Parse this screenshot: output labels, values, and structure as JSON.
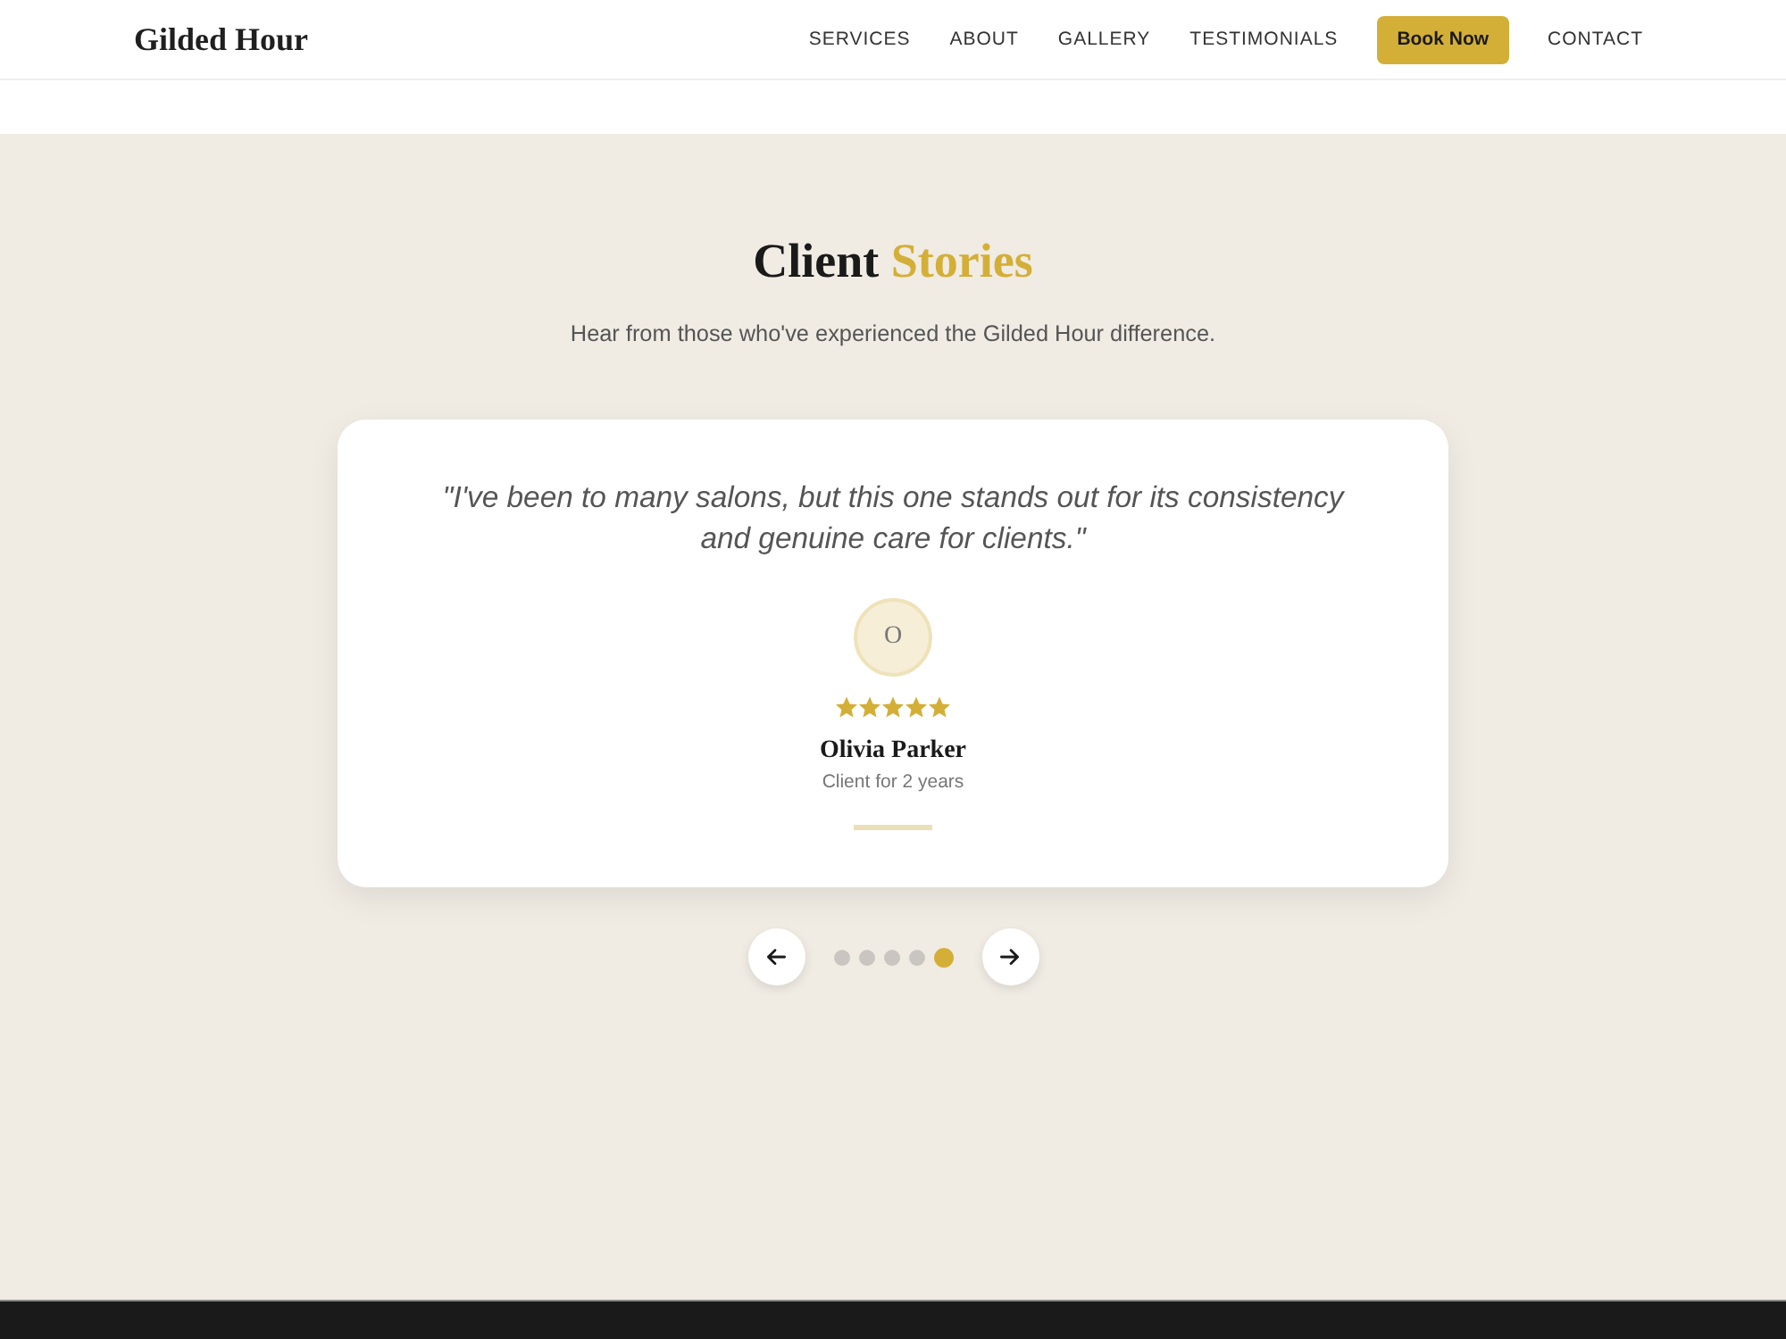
{
  "header": {
    "logo": "Gilded Hour",
    "nav": [
      {
        "label": "SERVICES",
        "kind": "link"
      },
      {
        "label": "ABOUT",
        "kind": "link"
      },
      {
        "label": "GALLERY",
        "kind": "link"
      },
      {
        "label": "TESTIMONIALS",
        "kind": "link"
      },
      {
        "label": "Book Now",
        "kind": "button"
      },
      {
        "label": "CONTACT",
        "kind": "link"
      }
    ]
  },
  "section": {
    "title": [
      {
        "text": "Client",
        "accent": false
      },
      {
        "text": "Stories",
        "accent": true
      }
    ],
    "subtitle": "Hear from those who've experienced the Gilded Hour difference."
  },
  "testimonial": {
    "quote": "\"I've been to many salons, but this one stands out for its consistency and genuine care for clients.\"",
    "avatar_initial": "O",
    "stars": 5,
    "name": "Olivia Parker",
    "since": "Client for 2 years"
  },
  "carousel": {
    "dots": [
      {
        "selected": false
      },
      {
        "selected": false
      },
      {
        "selected": false
      },
      {
        "selected": false
      },
      {
        "selected": true
      }
    ]
  }
}
